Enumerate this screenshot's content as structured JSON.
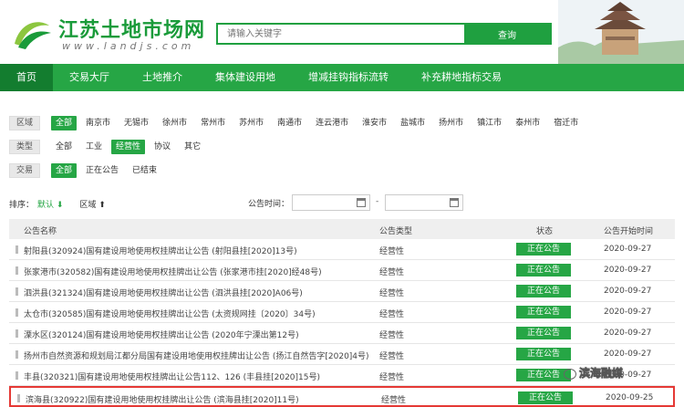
{
  "header": {
    "site_title": "江苏土地市场网",
    "site_url": "www.landjs.com",
    "search_placeholder": "请输入关键字",
    "search_button": "查询"
  },
  "nav": [
    {
      "label": "首页",
      "active": true
    },
    {
      "label": "交易大厅"
    },
    {
      "label": "土地推介"
    },
    {
      "label": "集体建设用地"
    },
    {
      "label": "增减挂钩指标流转"
    },
    {
      "label": "补充耕地指标交易"
    }
  ],
  "filters": {
    "region": {
      "label": "区域",
      "options": [
        "全部",
        "南京市",
        "无锡市",
        "徐州市",
        "常州市",
        "苏州市",
        "南通市",
        "连云港市",
        "淮安市",
        "盐城市",
        "扬州市",
        "镇江市",
        "泰州市",
        "宿迁市"
      ],
      "active": 0
    },
    "type": {
      "label": "类型",
      "options": [
        "全部",
        "工业",
        "经营性",
        "协议",
        "其它"
      ],
      "active": 2
    },
    "trade": {
      "label": "交易",
      "options": [
        "全部",
        "正在公告",
        "已结束"
      ],
      "active": 0
    }
  },
  "sort": {
    "label": "排序：",
    "default": "默认 ⬇",
    "region": "区域 ⬆",
    "date_label": "公告时间：",
    "dash": "-"
  },
  "table": {
    "headers": {
      "name": "公告名称",
      "type": "公告类型",
      "status": "状态",
      "date": "公告开始时间"
    },
    "rows": [
      {
        "name": "射阳县(320924)国有建设用地使用权挂牌出让公告 (射阳县挂[2020]13号)",
        "type": "经营性",
        "status": "正在公告",
        "date": "2020-09-27"
      },
      {
        "name": "张家港市(320582)国有建设用地使用权挂牌出让公告 (张家港市挂[2020]经48号)",
        "type": "经营性",
        "status": "正在公告",
        "date": "2020-09-27"
      },
      {
        "name": "泗洪县(321324)国有建设用地使用权挂牌出让公告 (泗洪县挂[2020]A06号)",
        "type": "经营性",
        "status": "正在公告",
        "date": "2020-09-27"
      },
      {
        "name": "太仓市(320585)国有建设用地使用权挂牌出让公告 (太资规网挂〔2020〕34号)",
        "type": "经营性",
        "status": "正在公告",
        "date": "2020-09-27"
      },
      {
        "name": "溧水区(320124)国有建设用地使用权挂牌出让公告 (2020年宁溧出第12号)",
        "type": "经营性",
        "status": "正在公告",
        "date": "2020-09-27"
      },
      {
        "name": "扬州市自然资源和规划局江都分局国有建设用地使用权挂牌出让公告 (扬江自然告字[2020]4号)",
        "type": "经营性",
        "status": "正在公告",
        "date": "2020-09-27"
      },
      {
        "name": "丰县(320321)国有建设用地使用权挂牌出让公告112、126 (丰县挂[2020]15号)",
        "type": "经营性",
        "status": "正在公告",
        "date": "2020-09-27"
      },
      {
        "name": "滨海县(320922)国有建设用地使用权挂牌出让公告 (滨海县挂[2020]11号)",
        "type": "经营性",
        "status": "正在公告",
        "date": "2020-09-25",
        "highlight": true
      }
    ]
  },
  "watermark": "滨海融媒",
  "colors": {
    "brand_green": "#26a645",
    "nav_active": "#137d2f",
    "highlight_border": "#e53935"
  }
}
